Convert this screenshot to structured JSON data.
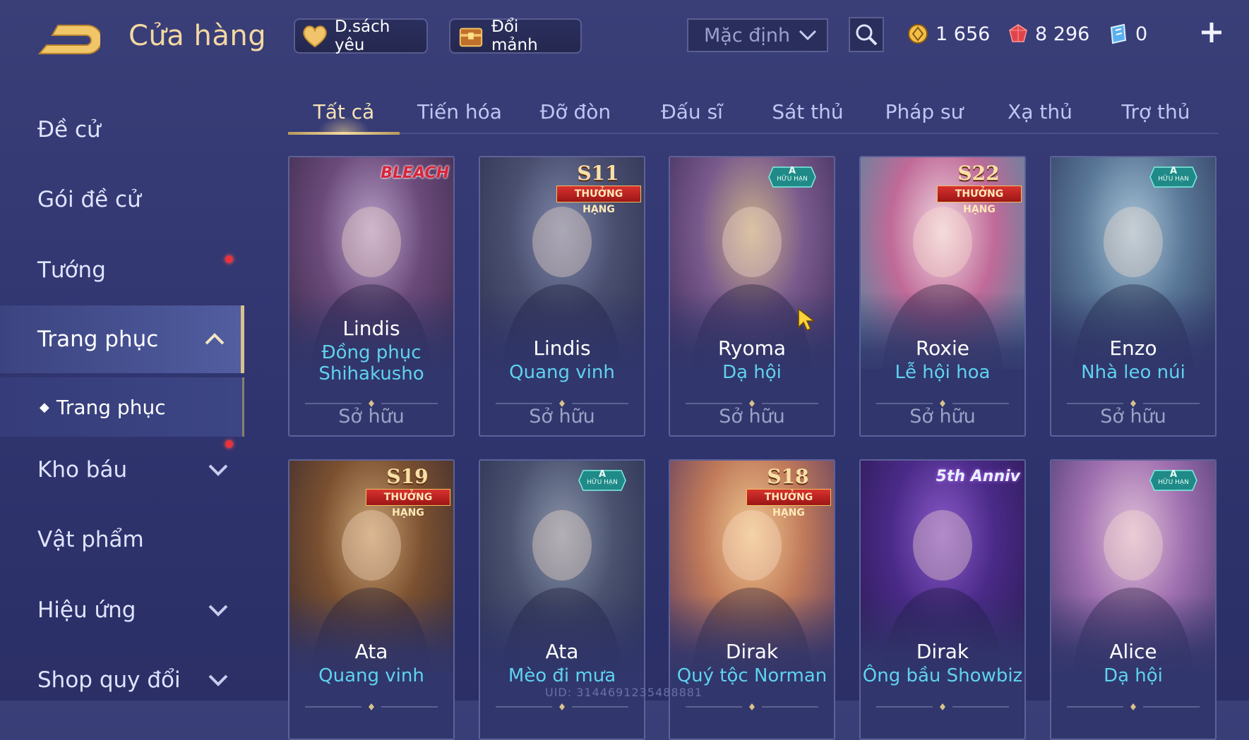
{
  "header": {
    "title": "Cửa hàng",
    "wishlist_label": "D.sách yêu",
    "exchange_label": "Đổi mảnh",
    "sort_value": "Mặc định"
  },
  "currencies": [
    {
      "icon": "gold-coin-icon",
      "value": "1 656"
    },
    {
      "icon": "red-gem-icon",
      "value": "8 296"
    },
    {
      "icon": "blue-voucher-icon",
      "value": "0"
    }
  ],
  "sidebar": {
    "items": [
      {
        "label": "Đề cử"
      },
      {
        "label": "Gói đề cử"
      },
      {
        "label": "Tướng"
      },
      {
        "label": "Trang phục"
      },
      {
        "label": "Kho báu"
      },
      {
        "label": "Vật phẩm"
      },
      {
        "label": "Hiệu ứng"
      },
      {
        "label": "Shop quy đổi"
      }
    ],
    "sub_item": "Trang phục"
  },
  "tabs": [
    "Tất cả",
    "Tiến hóa",
    "Đỡ đòn",
    "Đấu sĩ",
    "Sát thủ",
    "Pháp sư",
    "Xạ thủ",
    "Trợ thủ"
  ],
  "cards": [
    {
      "hero": "Lindis",
      "skin_line1": "Đồng phục",
      "skin_line2": "Shihakusho",
      "owned": "Sở hữu",
      "badge_type": "text",
      "badge_main": "BLEACH",
      "badge_sub": "",
      "art": [
        "#b7a0c8",
        "#6b4a7a",
        "#3a2a4a"
      ]
    },
    {
      "hero": "Lindis",
      "skin_line1": "Quang vinh",
      "skin_line2": "",
      "owned": "Sở hữu",
      "badge_type": "rank",
      "badge_main": "S11",
      "badge_sub": "THƯỞNG HẠNG",
      "art": [
        "#7e87a8",
        "#4a4f70",
        "#2d3050"
      ]
    },
    {
      "hero": "Ryoma",
      "skin_line1": "Dạ hội",
      "skin_line2": "",
      "owned": "Sở hữu",
      "badge_type": "a",
      "badge_main": "A",
      "badge_sub": "HỮU HẠN",
      "art": [
        "#c8b08a",
        "#7a5a8c",
        "#3b2c5a"
      ]
    },
    {
      "hero": "Roxie",
      "skin_line1": "Lễ hội hoa",
      "skin_line2": "",
      "owned": "Sở hữu",
      "badge_type": "rank",
      "badge_main": "S22",
      "badge_sub": "THƯỞNG HẠNG",
      "art": [
        "#f0d8e0",
        "#c06a98",
        "#4a8aa0"
      ]
    },
    {
      "hero": "Enzo",
      "skin_line1": "Nhà leo núi",
      "skin_line2": "",
      "owned": "Sở hữu",
      "badge_type": "a",
      "badge_main": "A",
      "badge_sub": "HỮU HẠN",
      "art": [
        "#a8c4d8",
        "#5a7898",
        "#2e3a60"
      ]
    },
    {
      "hero": "Ata",
      "skin_line1": "Quang vinh",
      "skin_line2": "",
      "owned": "",
      "badge_type": "rank",
      "badge_main": "S19",
      "badge_sub": "THƯỞNG HẠNG",
      "art": [
        "#c8a070",
        "#7a5030",
        "#3a2a30"
      ]
    },
    {
      "hero": "Ata",
      "skin_line1": "Mèo đi mưa",
      "skin_line2": "",
      "owned": "",
      "badge_type": "a",
      "badge_main": "A",
      "badge_sub": "HỮU HẠN",
      "art": [
        "#8a94a8",
        "#4a5270",
        "#2a3050"
      ]
    },
    {
      "hero": "Dirak",
      "skin_line1": "Quý tộc Norman",
      "skin_line2": "",
      "owned": "",
      "badge_type": "rank",
      "badge_main": "S18",
      "badge_sub": "THƯỞNG HẠNG",
      "art": [
        "#f0c890",
        "#c07a5a",
        "#5a3a60"
      ]
    },
    {
      "hero": "Dirak",
      "skin_line1": "Ông bầu Showbiz",
      "skin_line2": "",
      "owned": "",
      "badge_type": "text",
      "badge_main": "5th Anniv",
      "badge_sub": "",
      "art": [
        "#8a5ac8",
        "#4a2a88",
        "#2a1a50"
      ]
    },
    {
      "hero": "Alice",
      "skin_line1": "Dạ hội",
      "skin_line2": "",
      "owned": "",
      "badge_type": "a",
      "badge_main": "A",
      "badge_sub": "HỮU HẠN",
      "art": [
        "#e0c0d8",
        "#a070b0",
        "#4a3a70"
      ]
    }
  ],
  "uid_text": "UID: 3144691235488881",
  "colors": {
    "accent_gold": "#f3d9a2",
    "skin_cyan": "#5fd2ee",
    "notify_red": "#e8333b"
  }
}
